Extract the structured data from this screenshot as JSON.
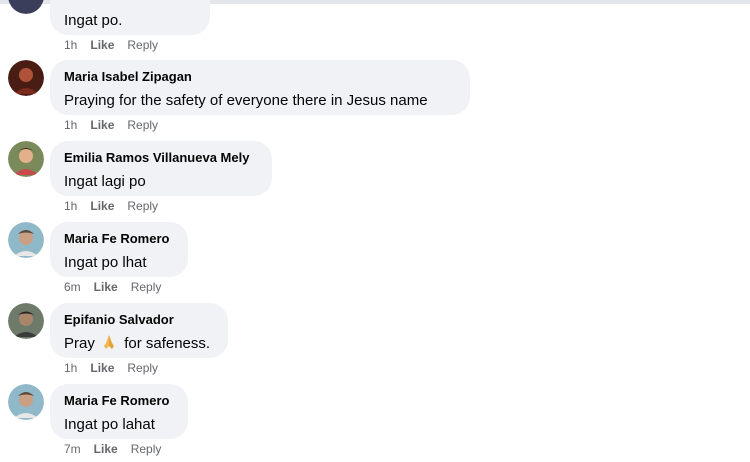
{
  "comments": [
    {
      "author": "",
      "text": "Ingat po.",
      "time": "1h",
      "like": "Like",
      "reply": "Reply"
    },
    {
      "author": "Maria Isabel Zipagan",
      "text": "Praying for the safety of everyone there in Jesus name",
      "time": "1h",
      "like": "Like",
      "reply": "Reply"
    },
    {
      "author": "Emilia Ramos Villanueva Mely",
      "text": "Ingat lagi po",
      "time": "1h",
      "like": "Like",
      "reply": "Reply"
    },
    {
      "author": "Maria Fe Romero",
      "text": "Ingat po lhat",
      "time": "6m",
      "like": "Like",
      "reply": "Reply"
    },
    {
      "author": "Epifanio Salvador",
      "text_before": "Pray",
      "emoji": "folded-hands-icon",
      "text_after": "for safeness.",
      "time": "1h",
      "like": "Like",
      "reply": "Reply"
    },
    {
      "author": "Maria Fe Romero",
      "text": "Ingat po lahat",
      "time": "7m",
      "like": "Like",
      "reply": "Reply"
    }
  ],
  "colors": {
    "bubble": "#f0f2f5",
    "meta_text": "#65676b",
    "primary_text": "#050505"
  }
}
